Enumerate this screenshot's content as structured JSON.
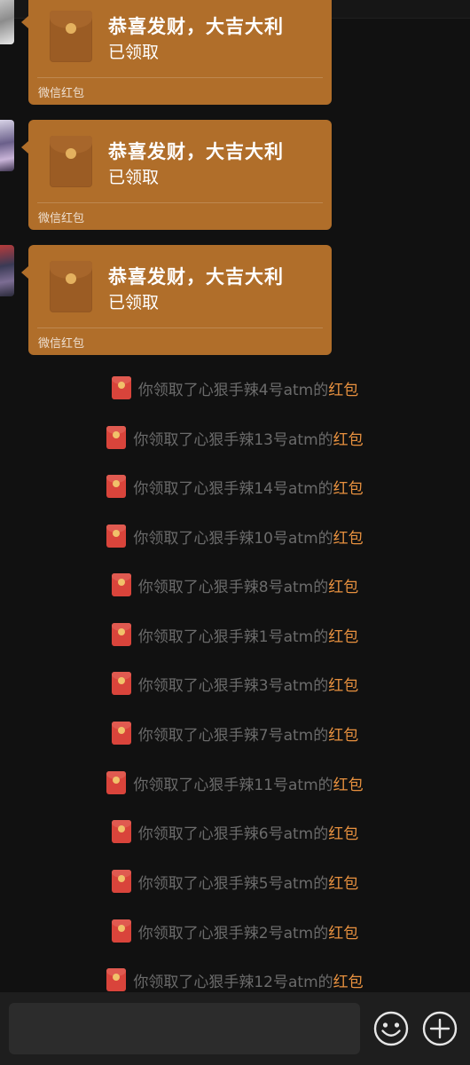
{
  "packets": [
    {
      "title": "恭喜发财，大吉大利",
      "status": "已领取",
      "footer": "微信红包"
    },
    {
      "title": "恭喜发财，大吉大利",
      "status": "已领取",
      "footer": "微信红包"
    },
    {
      "title": "恭喜发财，大吉大利",
      "status": "已领取",
      "footer": "微信红包"
    }
  ],
  "notices": [
    {
      "text": "你领取了心狠手辣4号atm的",
      "link": "红包"
    },
    {
      "text": "你领取了心狠手辣13号atm的",
      "link": "红包"
    },
    {
      "text": "你领取了心狠手辣14号atm的",
      "link": "红包"
    },
    {
      "text": "你领取了心狠手辣10号atm的",
      "link": "红包"
    },
    {
      "text": "你领取了心狠手辣8号atm的",
      "link": "红包"
    },
    {
      "text": "你领取了心狠手辣1号atm的",
      "link": "红包"
    },
    {
      "text": "你领取了心狠手辣3号atm的",
      "link": "红包"
    },
    {
      "text": "你领取了心狠手辣7号atm的",
      "link": "红包"
    },
    {
      "text": "你领取了心狠手辣11号atm的",
      "link": "红包"
    },
    {
      "text": "你领取了心狠手辣6号atm的",
      "link": "红包"
    },
    {
      "text": "你领取了心狠手辣5号atm的",
      "link": "红包"
    },
    {
      "text": "你领取了心狠手辣2号atm的",
      "link": "红包"
    },
    {
      "text": "你领取了心狠手辣12号atm的",
      "link": "红包"
    }
  ],
  "input": {
    "value": "",
    "placeholder": ""
  },
  "icons": {
    "emoji": "smiley-face-icon",
    "more": "plus-circle-icon",
    "notice": "red-packet-icon"
  },
  "colors": {
    "packet": "#b06e2a",
    "link": "#e8913f",
    "background": "#111111"
  }
}
